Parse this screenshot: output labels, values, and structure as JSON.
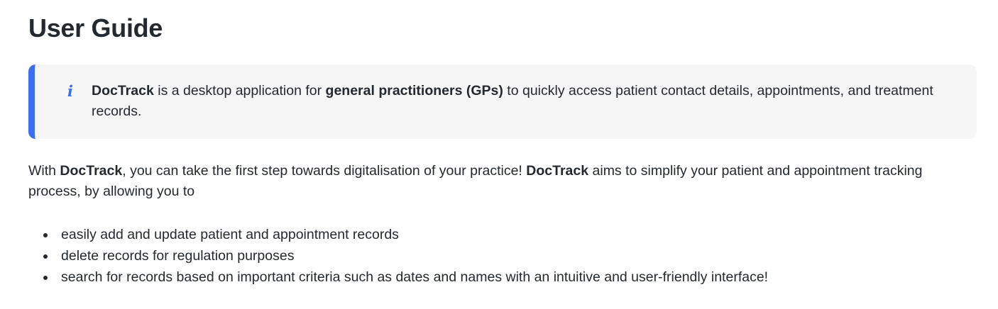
{
  "page": {
    "title": "User Guide"
  },
  "callout": {
    "icon": "info-icon",
    "icon_glyph": "i",
    "accent_color": "#3b6ef0",
    "product": "DocTrack",
    "text_1": " is a desktop application for ",
    "audience": "general practitioners (GPs)",
    "text_2": " to quickly access patient contact details, appointments, and treatment records."
  },
  "intro": {
    "text_1": "With ",
    "product_1": "DocTrack",
    "text_2": ", you can take the first step towards digitalisation of your practice! ",
    "product_2": "DocTrack",
    "text_3": " aims to simplify your patient and appointment tracking process, by allowing you to"
  },
  "features": [
    "easily add and update patient and appointment records",
    "delete records for regulation purposes",
    "search for records based on important criteria such as dates and names with an intuitive and user-friendly interface!"
  ]
}
